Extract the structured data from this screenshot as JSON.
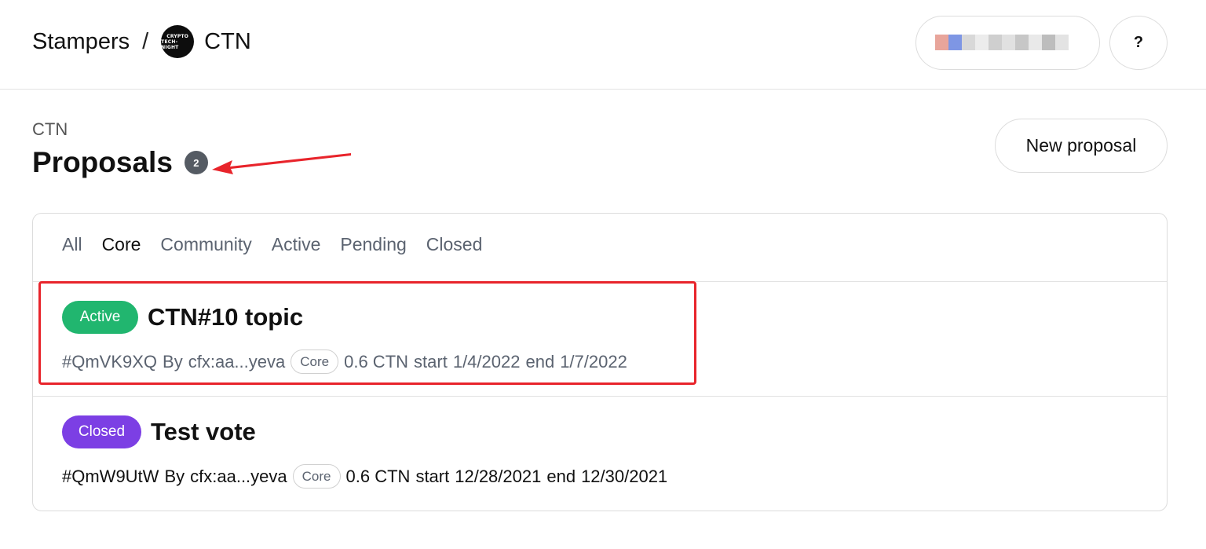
{
  "header": {
    "breadcrumb_root": "Stampers",
    "breadcrumb_separator": "/",
    "space_logo_line1": "CRYPTO",
    "space_logo_line2": "TECH-NIGHT",
    "space_name": "CTN",
    "help_label": "?"
  },
  "page": {
    "space_label": "CTN",
    "title": "Proposals",
    "count": "2",
    "new_proposal_label": "New proposal"
  },
  "filters": [
    "All",
    "Core",
    "Community",
    "Active",
    "Pending",
    "Closed"
  ],
  "selected_filter": "Core",
  "proposals": [
    {
      "state": "Active",
      "title": "CTN#10 topic",
      "id": "#QmVK9XQ",
      "author_prefix": "By",
      "author": "cfx:aa...yeva",
      "category": "Core",
      "amount": "0.6 CTN",
      "start_label": "start",
      "start": "1/4/2022",
      "end_label": "end",
      "end": "1/7/2022"
    },
    {
      "state": "Closed",
      "title": "Test vote",
      "id": "#QmW9UtW",
      "author_prefix": "By",
      "author": "cfx:aa...yeva",
      "category": "Core",
      "amount": "0.6 CTN",
      "start_label": "start",
      "start": "12/28/2021",
      "end_label": "end",
      "end": "12/30/2021"
    }
  ],
  "colors": {
    "active_badge": "#21b66f",
    "closed_badge": "#7c3fe4",
    "count_badge": "#555b63",
    "annotation_red": "#e8242b"
  }
}
